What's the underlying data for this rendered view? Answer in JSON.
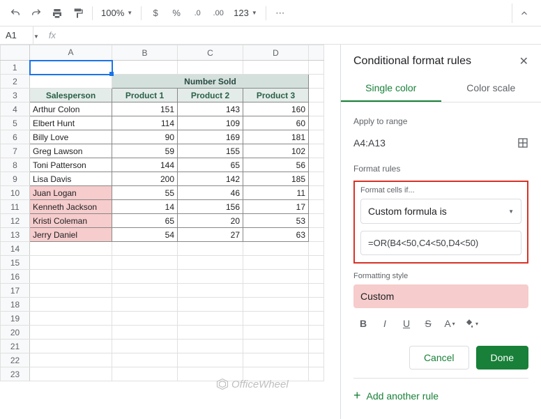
{
  "toolbar": {
    "zoom": "100%",
    "nf_123": "123"
  },
  "name_box": "A1",
  "columns": [
    "A",
    "B",
    "C",
    "D"
  ],
  "table": {
    "merged_header": "Number Sold",
    "headers": [
      "Salesperson",
      "Product 1",
      "Product 2",
      "Product 3"
    ],
    "rows": [
      {
        "name": "Arthur Colon",
        "v": [
          151,
          143,
          160
        ],
        "hl": false
      },
      {
        "name": "Elbert Hunt",
        "v": [
          114,
          109,
          60
        ],
        "hl": false
      },
      {
        "name": "Billy Love",
        "v": [
          90,
          169,
          181
        ],
        "hl": false
      },
      {
        "name": "Greg Lawson",
        "v": [
          59,
          155,
          102
        ],
        "hl": false
      },
      {
        "name": "Toni Patterson",
        "v": [
          144,
          65,
          56
        ],
        "hl": false
      },
      {
        "name": "Lisa Davis",
        "v": [
          200,
          142,
          185
        ],
        "hl": false
      },
      {
        "name": "Juan Logan",
        "v": [
          55,
          46,
          11
        ],
        "hl": true
      },
      {
        "name": "Kenneth Jackson",
        "v": [
          14,
          156,
          17
        ],
        "hl": true
      },
      {
        "name": "Kristi Coleman",
        "v": [
          65,
          20,
          53
        ],
        "hl": true
      },
      {
        "name": "Jerry Daniel",
        "v": [
          54,
          27,
          63
        ],
        "hl": true
      }
    ]
  },
  "watermark": "OfficeWheel",
  "sidebar": {
    "title": "Conditional format rules",
    "tabs": {
      "single": "Single color",
      "scale": "Color scale"
    },
    "apply_label": "Apply to range",
    "range": "A4:A13",
    "rules_label": "Format rules",
    "cells_if": "Format cells if...",
    "condition": "Custom formula is",
    "formula": "=OR(B4<50,C4<50,D4<50)",
    "style_label": "Formatting style",
    "style_name": "Custom",
    "cancel": "Cancel",
    "done": "Done",
    "add": "Add another rule"
  }
}
